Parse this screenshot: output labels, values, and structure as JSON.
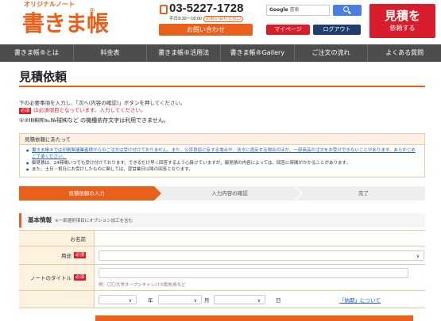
{
  "header": {
    "logo_sub": "オリジナルノート",
    "logo": "書きま帳",
    "logo_mark": "®",
    "phone": "03-5227-1728",
    "hours": "平日9:30～18:00",
    "hours_badge": "お問い合わせ窓口",
    "contact_label": "お問い合わせ",
    "search_brand": "Google",
    "search_placeholder": "書索",
    "mypage_label": "マイページ",
    "logout_label": "ログアウト",
    "quote_line1": "見積を",
    "quote_line2": "依頼する"
  },
  "nav": {
    "items": [
      "書きま帳®とは",
      "料金表",
      "書きま帳®活用法",
      "書きま帳®Gallery",
      "ご注文の流れ",
      "よくある質問"
    ]
  },
  "page": {
    "title": "見積依頼",
    "instruction": "下の必要事項を入力し、「次へ(内容の確認)」ボタンを押してください。",
    "required_badge": "必須",
    "required_text": "は必須項目となっています。入力してください。",
    "warning": "①②ⅠⅡ㈱㈲℡№㍻㈱など の機種依存文字は利用できません。"
  },
  "notice": {
    "heading": "見積依頼にあたって",
    "items": [
      "書きま帳®では印刷関連業者様からのご注文は受け付けておりません。また、公序良俗に反する場合や、法令に違反する場合のほか、一部商品の注文をお受けできないことがあります。あらかじめご了承ください。",
      "御見積は、24時間いつでも受け付けております。できるだけ早く回答するよう心掛けていますが、御見積の内容によっては、回答に時間がかかることがあります。",
      "また、土日・祝日にお受けしたものに関しては、翌営業日以降の回答となります。"
    ]
  },
  "steps": {
    "step1": "見積依頼の入力",
    "step2": "入力内容の確認",
    "step3": "完了"
  },
  "form": {
    "section_title": "基本情報",
    "section_sub": "※一部選択項目にオプション加工を含む",
    "name_label": "お名前",
    "use_label": "用途",
    "notebook_title_label": "ノートのタイトル",
    "title_hint": "例：〇〇大学オープンキャンパス配布用など",
    "year_label": "年",
    "month_label": "月",
    "day_label": "日",
    "deadline_link": "「納期」について",
    "select_arrow": "∨",
    "required_badge": "必須"
  },
  "colors": {
    "accent": "#e8601c",
    "red": "#d81e2c",
    "navy": "#1f3d6e",
    "nav_bg": "#4d4d4d"
  }
}
